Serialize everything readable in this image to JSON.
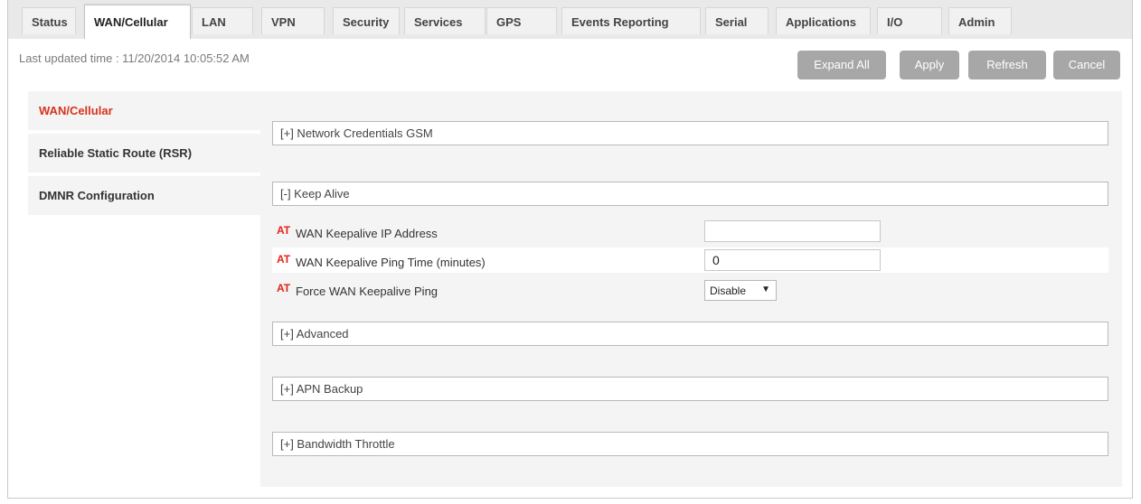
{
  "tabs": [
    {
      "label": "Status"
    },
    {
      "label": "WAN/Cellular"
    },
    {
      "label": "LAN"
    },
    {
      "label": "VPN"
    },
    {
      "label": "Security"
    },
    {
      "label": "Services"
    },
    {
      "label": "GPS"
    },
    {
      "label": "Events Reporting"
    },
    {
      "label": "Serial"
    },
    {
      "label": "Applications"
    },
    {
      "label": "I/O"
    },
    {
      "label": "Admin"
    }
  ],
  "active_tab": "WAN/Cellular",
  "last_updated": "Last updated time : 11/20/2014 10:05:52 AM",
  "toolbar": {
    "expand_all": "Expand All",
    "apply": "Apply",
    "refresh": "Refresh",
    "cancel": "Cancel"
  },
  "sidebar": {
    "items": [
      {
        "label": "WAN/Cellular",
        "active": true
      },
      {
        "label": "Reliable Static Route (RSR)",
        "active": false
      },
      {
        "label": "DMNR Configuration",
        "active": false
      }
    ]
  },
  "sections": {
    "network_credentials": "[+] Network Credentials GSM",
    "keep_alive": "[-] Keep Alive",
    "advanced": "[+] Advanced",
    "apn_backup": "[+] APN Backup",
    "bandwidth_throttle": "[+] Bandwidth Throttle"
  },
  "keep_alive_fields": {
    "at_marker": "AT",
    "ip_address": {
      "label": "WAN Keepalive IP Address",
      "value": ""
    },
    "ping_time": {
      "label": "WAN Keepalive Ping Time (minutes)",
      "value": "0"
    },
    "force_ping": {
      "label": "Force WAN Keepalive Ping",
      "value": "Disable"
    }
  },
  "colors": {
    "accent": "#d6331f",
    "at_marker": "#e2231a",
    "button_bg": "#a7a7a7"
  }
}
